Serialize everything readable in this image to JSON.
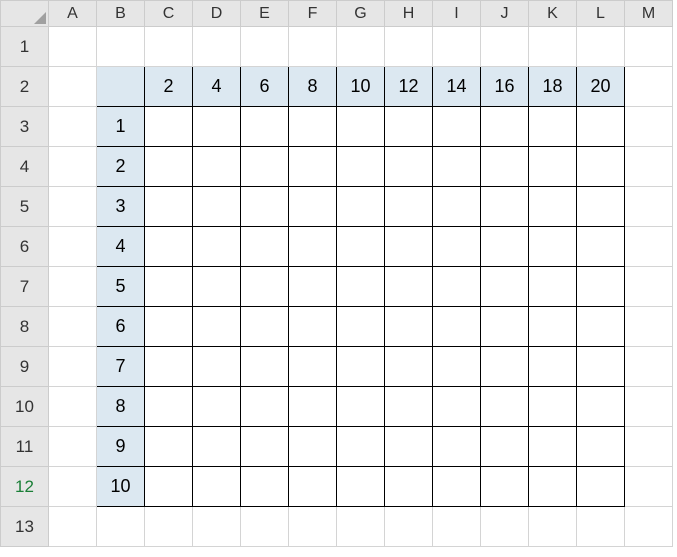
{
  "columns": [
    "A",
    "B",
    "C",
    "D",
    "E",
    "F",
    "G",
    "H",
    "I",
    "J",
    "K",
    "L",
    "M"
  ],
  "rows": [
    "1",
    "2",
    "3",
    "4",
    "5",
    "6",
    "7",
    "8",
    "9",
    "10",
    "11",
    "12",
    "13"
  ],
  "selected_row": "12",
  "chart_data": {
    "type": "table",
    "title": "",
    "top_headers": [
      "2",
      "4",
      "6",
      "8",
      "10",
      "12",
      "14",
      "16",
      "18",
      "20"
    ],
    "left_headers": [
      "1",
      "2",
      "3",
      "4",
      "5",
      "6",
      "7",
      "8",
      "9",
      "10"
    ],
    "body": [
      [
        "",
        "",
        "",
        "",
        "",
        "",
        "",
        "",
        "",
        ""
      ],
      [
        "",
        "",
        "",
        "",
        "",
        "",
        "",
        "",
        "",
        ""
      ],
      [
        "",
        "",
        "",
        "",
        "",
        "",
        "",
        "",
        "",
        ""
      ],
      [
        "",
        "",
        "",
        "",
        "",
        "",
        "",
        "",
        "",
        ""
      ],
      [
        "",
        "",
        "",
        "",
        "",
        "",
        "",
        "",
        "",
        ""
      ],
      [
        "",
        "",
        "",
        "",
        "",
        "",
        "",
        "",
        "",
        ""
      ],
      [
        "",
        "",
        "",
        "",
        "",
        "",
        "",
        "",
        "",
        ""
      ],
      [
        "",
        "",
        "",
        "",
        "",
        "",
        "",
        "",
        "",
        ""
      ],
      [
        "",
        "",
        "",
        "",
        "",
        "",
        "",
        "",
        "",
        ""
      ],
      [
        "",
        "",
        "",
        "",
        "",
        "",
        "",
        "",
        "",
        ""
      ]
    ]
  }
}
